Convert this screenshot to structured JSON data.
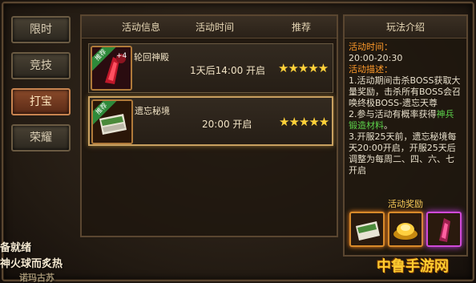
{
  "side_tabs": [
    {
      "label": "限时",
      "active": false
    },
    {
      "label": "竞技",
      "active": false
    },
    {
      "label": "打宝",
      "active": true
    },
    {
      "label": "荣耀",
      "active": false
    }
  ],
  "list": {
    "headers": {
      "info": "活动信息",
      "time": "活动时间",
      "rating": "推荐"
    },
    "events": [
      {
        "name": "轮回神殿",
        "time": "1天后14:00 开启",
        "stars": "★★★★★",
        "ribbon": "推荐",
        "icon_badge": "+4",
        "selected": false
      },
      {
        "name": "遗忘秘境",
        "time": "20:00 开启",
        "stars": "★★★★★",
        "ribbon": "推荐",
        "selected": true
      }
    ]
  },
  "info": {
    "title": "玩法介绍",
    "time_label": "活动时间：",
    "time_value": "20:00-20:30",
    "desc_label": "活动描述：",
    "desc_1": "1.活动期间击杀BOSS获取大量奖励，击杀所有BOSS会召唤终极BOSS-遗忘天尊",
    "desc_2_a": "2.参与活动有概率获得",
    "desc_2_b": "神兵锻造材料",
    "desc_2_c": "。",
    "desc_3": "3.开服25天前，遗忘秘境每天20:00开启，开服25天后调整为每周二、四、六、七开启",
    "reward_title": "活动奖励"
  },
  "overlay": {
    "line1": "备就绪",
    "line2": "神火球而炙热",
    "line3": "诺玛古苏"
  },
  "watermark": "中鲁手游网",
  "colors": {
    "accent_orange": "#ff9a2a",
    "accent_green": "#5cd24a",
    "star": "#ffd23a"
  }
}
